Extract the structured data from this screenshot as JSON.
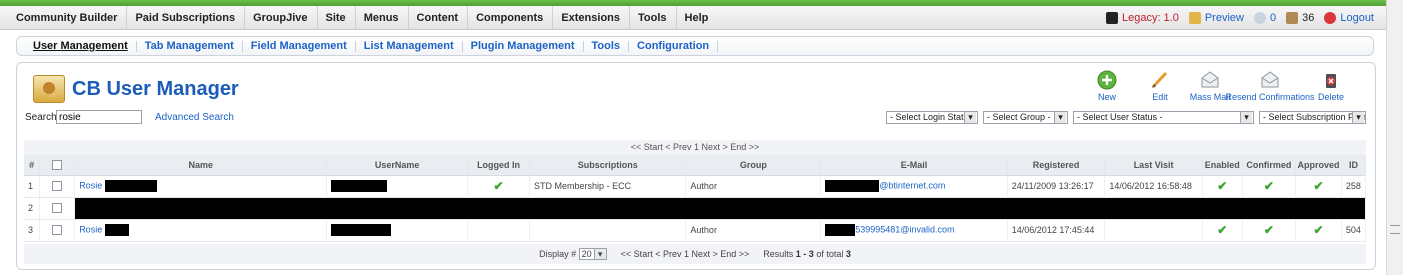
{
  "menubar": {
    "items": [
      "Community Builder",
      "Paid Subscriptions",
      "GroupJive",
      "Site",
      "Menus",
      "Content",
      "Components",
      "Extensions",
      "Tools",
      "Help"
    ],
    "legacy": "Legacy: 1.0",
    "preview": "Preview",
    "messages_count": "0",
    "users_count": "36",
    "logout": "Logout"
  },
  "submenu": {
    "items": [
      "User Management",
      "Tab Management",
      "Field Management",
      "List Management",
      "Plugin Management",
      "Tools",
      "Configuration"
    ],
    "active": "User Management"
  },
  "page": {
    "title": "CB User Manager"
  },
  "search": {
    "label": "Search:",
    "value": "rosie",
    "advanced": "Advanced Search"
  },
  "toolbar": {
    "buttons": [
      {
        "label": "New",
        "icon": "new-icon"
      },
      {
        "label": "Edit",
        "icon": "edit-icon"
      },
      {
        "label": "Mass Mail",
        "icon": "mass-mail-icon"
      },
      {
        "label": "Resend Confirmations",
        "icon": "resend-confirmations-icon"
      },
      {
        "label": "Delete",
        "icon": "delete-icon"
      }
    ]
  },
  "filters": {
    "login_state": "- Select Login State -",
    "group": "- Select Group -",
    "user_status": "- Select User Status -",
    "subscription_plan": "- Select Subscription Plan -"
  },
  "pager_top": "<< Start < Prev 1 Next > End >>",
  "table": {
    "headers": [
      "#",
      "",
      "Name",
      "UserName",
      "Logged In",
      "Subscriptions",
      "Group",
      "E-Mail",
      "Registered",
      "Last Visit",
      "Enabled",
      "Confirmed",
      "Approved",
      "ID"
    ],
    "rows": [
      {
        "num": "1",
        "name": "Rosie",
        "subscriptions": "STD Membership - ECC",
        "group": "Author",
        "email_suffix": "@btinternet.com",
        "registered": "24/11/2009 13:26:17",
        "last_visit": "14/06/2012 16:58:48",
        "id": "258"
      },
      {
        "num": "2"
      },
      {
        "num": "3",
        "name": "Rosie",
        "subscriptions": "",
        "group": "Author",
        "email_suffix": "539995481@invalid.com",
        "registered": "14/06/2012 17:45:44",
        "last_visit": "",
        "id": "504"
      }
    ]
  },
  "pager_bottom": {
    "display_label": "Display #",
    "display_value": "20",
    "nav": "<< Start < Prev 1 Next > End >>",
    "results_prefix": "Results",
    "results_range": "1 - 3",
    "results_of": "of total",
    "results_total": "3"
  },
  "colors": {
    "accent_green": "#5cb33e",
    "link_blue": "#1c63c7",
    "title_blue": "#1b5db8"
  }
}
